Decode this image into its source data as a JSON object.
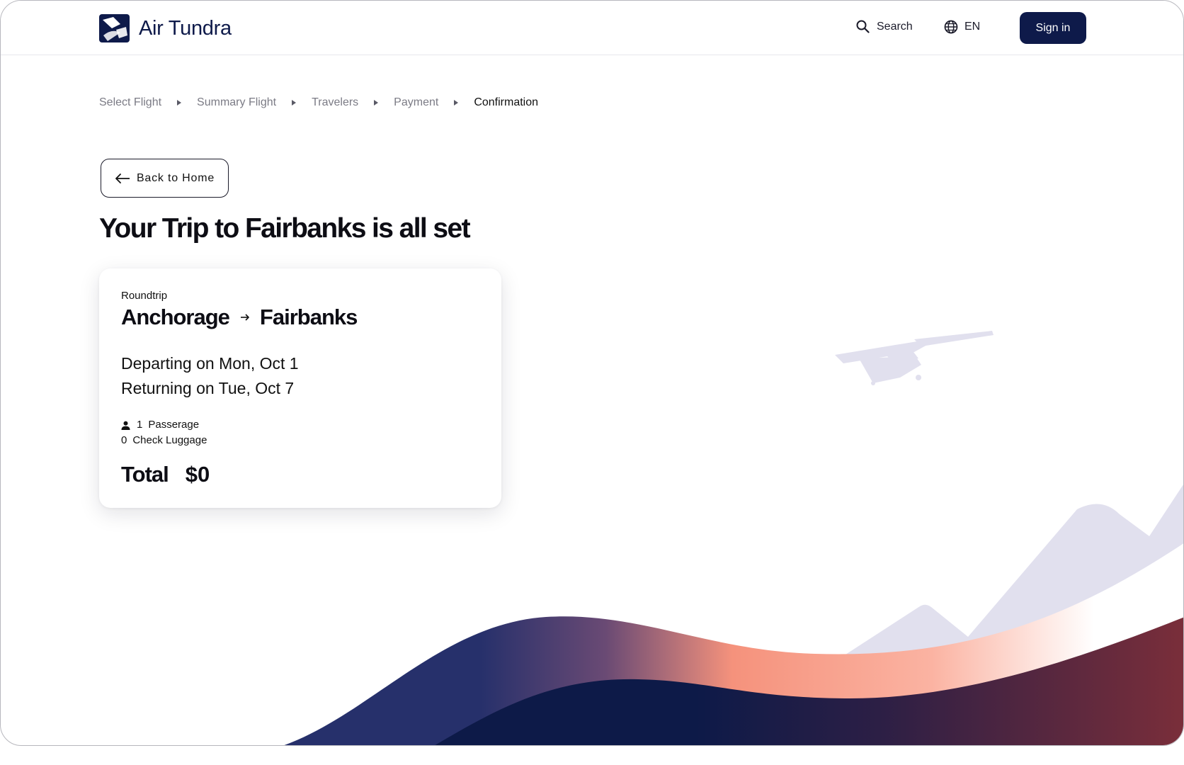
{
  "header": {
    "brand": "Air Tundra",
    "search_label": "Search",
    "language": "EN",
    "signin_label": "Sign in"
  },
  "breadcrumb": [
    "Select Flight",
    "Summary Flight",
    "Travelers",
    "Payment",
    "Confirmation"
  ],
  "breadcrumb_active": "Confirmation",
  "back_label": "Back to Home",
  "title": "Your Trip to Fairbanks is all set",
  "trip": {
    "type": "Roundtrip",
    "origin": "Anchorage",
    "destination": "Fairbanks",
    "departing": "Departing on Mon, Oct 1",
    "returning": "Returning on Tue, Oct 7",
    "passengers_count": "1",
    "passengers_label": "Passerage",
    "luggage_count": "0",
    "luggage_label": "Check Luggage",
    "total_label": "Total",
    "total_amount": "$0"
  },
  "icons": {
    "search": "search-icon",
    "language": "globe-icon",
    "back": "arrow-left-icon",
    "route": "arrow-right-icon",
    "passenger": "person-icon",
    "breadcrumb_sep": "caret-right-icon"
  },
  "colors": {
    "brand_navy": "#0e1a4a",
    "muted_text": "#7b7b85",
    "mountain": "#e1e0ee",
    "wave_coral": "#f7937c",
    "wave_maroon": "#7a2e3a"
  }
}
